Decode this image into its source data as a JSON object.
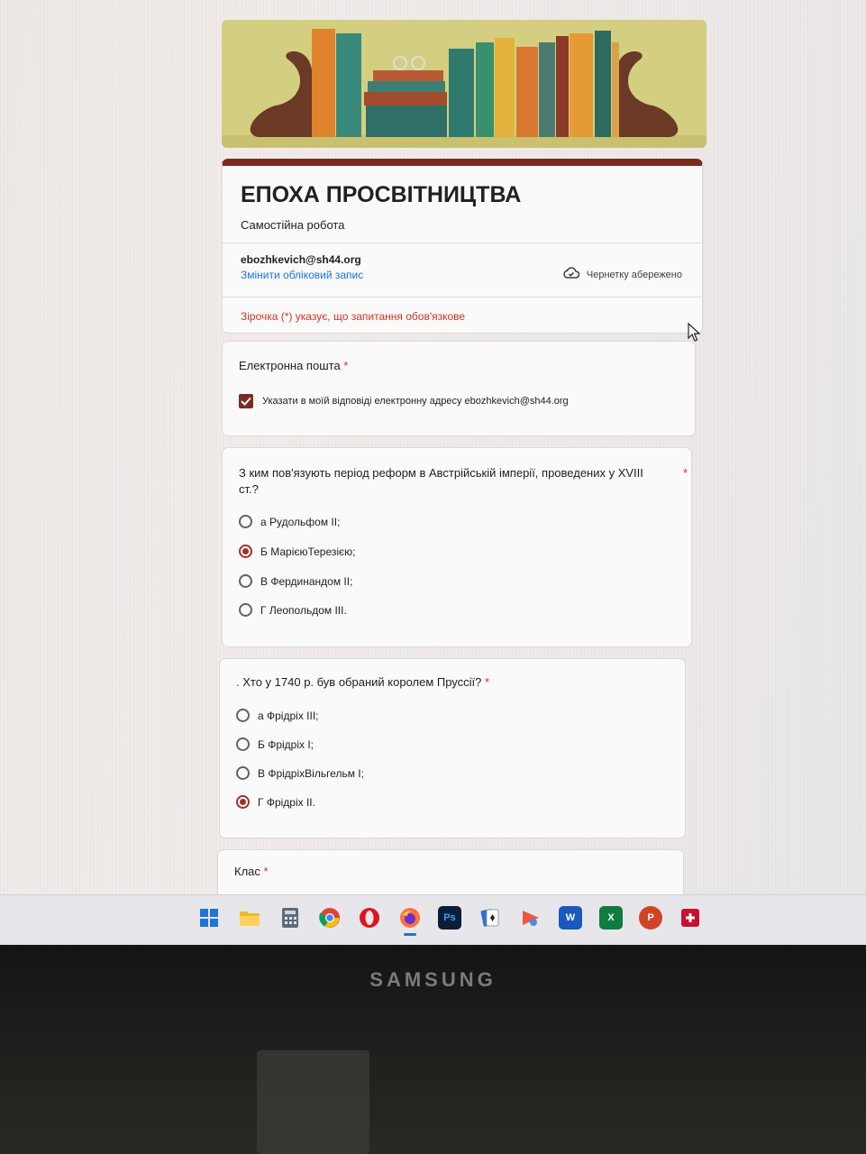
{
  "form": {
    "title": "ЕПОХА ПРОСВІТНИЦТВА",
    "description": "Самостійна робота",
    "account_email": "ebozhkevich@sh44.org",
    "switch_account": "Змінити обліковий запис",
    "draft_status": "Чернетку абережено",
    "required_note": "Зірочка (*) указує, що запитання обов'язкове"
  },
  "email_question": {
    "title": "Електронна пошта",
    "star": "*",
    "checkbox_label": "Указати в моїй відповіді електронну адресу ebozhkevich@sh44.org",
    "checked": true
  },
  "question1": {
    "title_line1": " З ким пов'язують період реформ в Австрійській імперії, проведених у XVIII",
    "title_line2": "ст.?",
    "star": "*",
    "options": [
      "а Рудольфом ІІ;",
      "Б МарієюТерезією;",
      "В Фердинандом ІІ;",
      "Г Леопольдом ІІІ."
    ],
    "selected": "Б МарієюТерезією;"
  },
  "question2": {
    "title": ". Хто у 1740 р. був обраний королем Пруссії?",
    "star": "*",
    "options": [
      "а Фрідріх ІІІ;",
      "Б Фрідріх І;",
      "В ФрідріхВільгельм І;",
      "Г Фрідріх ІІ."
    ],
    "selected": "Г Фрідріх ІІ."
  },
  "question3": {
    "title": "Клас",
    "star": "*"
  },
  "taskbar": {
    "icons": [
      "windows-start-icon",
      "file-explorer-icon",
      "calculator-icon",
      "chrome-icon",
      "opera-icon",
      "firefox-icon",
      "photoshop-icon",
      "solitaire-icon",
      "paint-icon",
      "word-icon",
      "excel-icon",
      "powerpoint-icon",
      "red-app-icon"
    ],
    "ps_label": "Ps",
    "word_label": "W",
    "excel_label": "X",
    "ppt_label": "P"
  },
  "monitor": {
    "brand": "SAMSUNG"
  },
  "colors": {
    "accent": "#7c2a20",
    "link": "#1a73e8",
    "required": "#d93025"
  }
}
